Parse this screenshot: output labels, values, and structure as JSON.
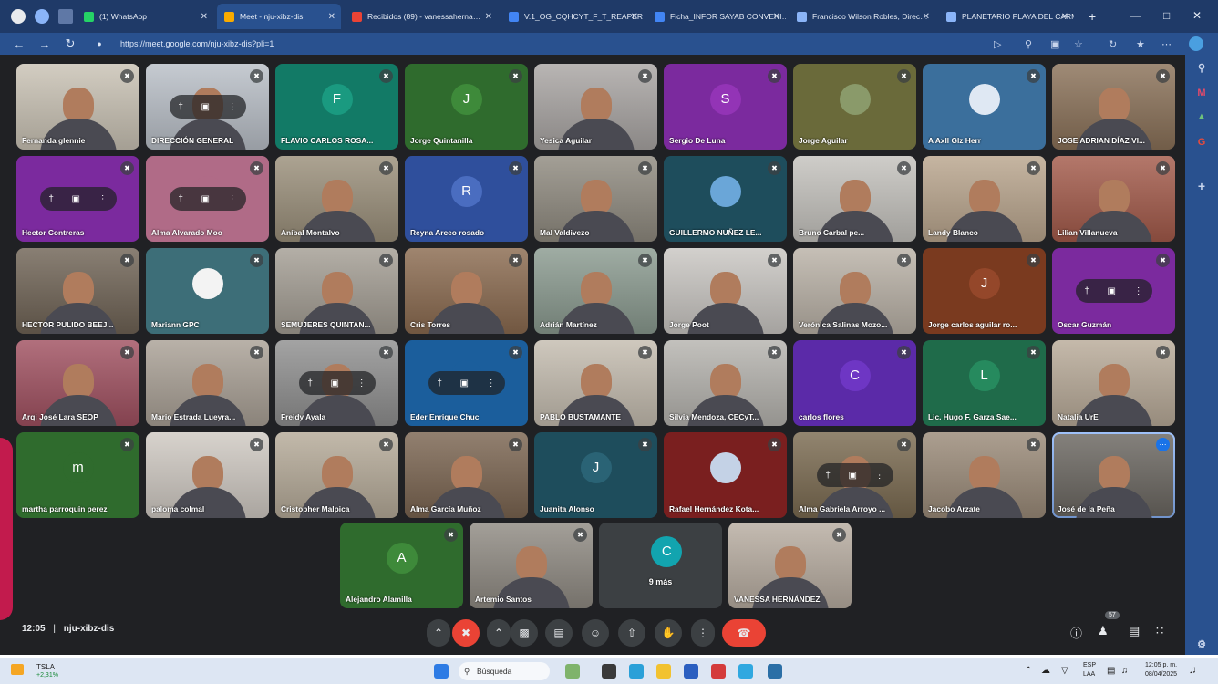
{
  "browser": {
    "tabs": [
      {
        "label": "(1) WhatsApp",
        "favicon": "whatsapp-icon",
        "color": "#25d366"
      },
      {
        "label": "Meet - nju-xibz-dis",
        "favicon": "meet-icon",
        "color": "#f9ab00",
        "active": true
      },
      {
        "label": "Recibidos (89) - vanessaherna…",
        "favicon": "gmail-icon",
        "color": "#ea4335"
      },
      {
        "label": "V.1_OG_CQHCYT_F_T_REAPER…",
        "favicon": "docs-icon",
        "color": "#4285f4"
      },
      {
        "label": "Ficha_INFOR SAYAB CONVENI…",
        "favicon": "docs-icon",
        "color": "#4285f4"
      },
      {
        "label": "Francisco Wilson Robles, Direc…",
        "favicon": "page-icon",
        "color": "#8ab4f8"
      },
      {
        "label": "PLANETARIO PLAYA DEL CARM…",
        "favicon": "page-icon",
        "color": "#8ab4f8"
      }
    ],
    "new_tab": "+",
    "url": "https://meet.google.com/nju-xibz-dis?pli=1"
  },
  "meet": {
    "time": "12:05",
    "separator": "|",
    "code": "nju-xibz-dis",
    "people_count": "57",
    "grid": [
      {
        "name": "Fernanda glennie",
        "kind": "video",
        "bg": "#c9c2b4"
      },
      {
        "name": "DIRECCIÓN GENERAL",
        "kind": "video",
        "bg": "#b9bfc7",
        "pill": true
      },
      {
        "name": "FLAVIO CARLOS ROSA...",
        "kind": "avatar",
        "letter": "F",
        "bg": "#127a66",
        "avatar_bg": "#1a9a80"
      },
      {
        "name": "Jorge Quintanilla",
        "kind": "avatar",
        "letter": "J",
        "bg": "#2f6b2d",
        "avatar_bg": "#3e8a3a"
      },
      {
        "name": "Yesica Aguilar",
        "kind": "video",
        "bg": "#a9a5a3"
      },
      {
        "name": "Sergio De Luna",
        "kind": "avatar",
        "letter": "S",
        "bg": "#7b2a9e",
        "avatar_bg": "#9334b6"
      },
      {
        "name": "Jorge Aguilar",
        "kind": "avatar",
        "letter": "",
        "bg": "#6a6a3a",
        "avatar_bg": "#8a9a6a"
      },
      {
        "name": "A Axll Glz Herr",
        "kind": "avatar",
        "letter": "",
        "bg": "#3b6f9c",
        "avatar_bg": "#dfe8f3"
      },
      {
        "name": "JOSE ADRIAN DÍAZ VI...",
        "kind": "video",
        "bg": "#8a7158"
      },
      {
        "name": "Hector Contreras",
        "kind": "avatar",
        "letter": "",
        "bg": "#7b2a9e",
        "avatar_bg": "#7b2a9e",
        "pill": true
      },
      {
        "name": "Alma Alvarado Moo",
        "kind": "avatar",
        "letter": "",
        "bg": "#b06b87",
        "avatar_bg": "#b06b87",
        "pill": true
      },
      {
        "name": "Aníbal Montalvo",
        "kind": "video",
        "bg": "#9a8f7a"
      },
      {
        "name": "Reyna Arceo rosado",
        "kind": "avatar",
        "letter": "R",
        "bg": "#2f4f9c",
        "avatar_bg": "#4a6dc0"
      },
      {
        "name": "Mal Valdivezo",
        "kind": "video",
        "bg": "#8f8a7f"
      },
      {
        "name": "GUILLERMO NUÑEZ LE...",
        "kind": "avatar",
        "letter": "",
        "bg": "#1e4d5c",
        "avatar_bg": "#6aa6d8"
      },
      {
        "name": "Bruno Carbal pe...",
        "kind": "video",
        "bg": "#c4c2bd"
      },
      {
        "name": "Landy Blanco",
        "kind": "video",
        "bg": "#b9a58d"
      },
      {
        "name": "Lilian Villanueva",
        "kind": "video",
        "bg": "#a35a4a"
      },
      {
        "name": "HECTOR PULIDO BEEJ...",
        "kind": "video",
        "bg": "#6f6355"
      },
      {
        "name": "Mariann GPC",
        "kind": "avatar",
        "letter": "",
        "bg": "#3d6e78",
        "avatar_bg": "#f3f3f3"
      },
      {
        "name": "SEMUJERES QUINTAN...",
        "kind": "video",
        "bg": "#a39d93"
      },
      {
        "name": "Cris Torres",
        "kind": "video",
        "bg": "#8a6a4f"
      },
      {
        "name": "Adrián Martínez",
        "kind": "video",
        "bg": "#8a9a8f"
      },
      {
        "name": "Jorge Poot",
        "kind": "video",
        "bg": "#c9c6c2"
      },
      {
        "name": "Verónica Salinas Mozo...",
        "kind": "video",
        "bg": "#b9b1a6"
      },
      {
        "name": "Jorge carlos aguilar ro...",
        "kind": "avatar",
        "letter": "J",
        "bg": "#7a3a1f",
        "avatar_bg": "#94472a"
      },
      {
        "name": "Oscar Guzmán",
        "kind": "avatar",
        "letter": "",
        "bg": "#7b2a9e",
        "avatar_bg": "#7b2a9e",
        "pill": true
      },
      {
        "name": "Arqi José Lara SEOP",
        "kind": "video",
        "bg": "#a05060"
      },
      {
        "name": "Mario Estrada Lueyra...",
        "kind": "video",
        "bg": "#a9a095"
      },
      {
        "name": "Freidy Ayala",
        "kind": "video",
        "bg": "#8f8f8f",
        "pill": true
      },
      {
        "name": "Eder Enrique Chuc",
        "kind": "avatar",
        "letter": "",
        "bg": "#1b5e9c",
        "avatar_bg": "#1b5e9c",
        "pill": true
      },
      {
        "name": "PABLO BUSTAMANTE",
        "kind": "video",
        "bg": "#c4bcaf"
      },
      {
        "name": "Silvia Mendoza, CECyT...",
        "kind": "video",
        "bg": "#b5b3ae"
      },
      {
        "name": "carlos flores",
        "kind": "avatar",
        "letter": "C",
        "bg": "#5b2aa8",
        "avatar_bg": "#6e36c4"
      },
      {
        "name": "Lic. Hugo F. Garza Sae...",
        "kind": "avatar",
        "letter": "L",
        "bg": "#1f6b4a",
        "avatar_bg": "#268a5e"
      },
      {
        "name": "Natalia UrE",
        "kind": "video",
        "bg": "#b8aa98"
      },
      {
        "name": "martha parroquin perez",
        "kind": "avatar",
        "letter": "m",
        "bg": "#2f6b2d",
        "avatar_bg": "#2f6b2d"
      },
      {
        "name": "paloma colmal",
        "kind": "video",
        "bg": "#cfc9c2"
      },
      {
        "name": "Cristopher Malpica",
        "kind": "video",
        "bg": "#b5aa98"
      },
      {
        "name": "Alma García Muñoz",
        "kind": "video",
        "bg": "#7a6450"
      },
      {
        "name": "Juanita Alonso",
        "kind": "avatar",
        "letter": "J",
        "bg": "#1e4d5c",
        "avatar_bg": "#2a6375"
      },
      {
        "name": "Rafael Hernández Kota...",
        "kind": "avatar",
        "letter": "",
        "bg": "#7a1f1f",
        "avatar_bg": "#c4d2e6"
      },
      {
        "name": "Alma Gabriela Arroyo ...",
        "kind": "video",
        "bg": "#7a6a50",
        "pill": true
      },
      {
        "name": "Jacobo Arzate",
        "kind": "video",
        "bg": "#9a8a78"
      },
      {
        "name": "José de la Peña",
        "kind": "video",
        "bg": "#6a6660",
        "border": true
      }
    ],
    "bottom_row": [
      {
        "name": "Alejandro Alamilla",
        "kind": "avatar",
        "letter": "A",
        "bg": "#2f6b2d",
        "avatar_bg": "#3e8a3a"
      },
      {
        "name": "Artemio Santos",
        "kind": "video",
        "bg": "#8f8a82"
      },
      {
        "name": "9 más",
        "kind": "more",
        "letter": "C",
        "bg": "#3c4043",
        "avatar_bg": "#12a4af"
      },
      {
        "name": "VANESSA HERNÁNDEZ",
        "kind": "video",
        "bg": "#b7aca0"
      }
    ]
  },
  "taskbar": {
    "stock": "TSLA",
    "stock_change": "+2,31%",
    "search_placeholder": "Búsqueda",
    "lang_top": "ESP",
    "lang_bottom": "LAA",
    "clock_time": "12:05 p. m.",
    "clock_date": "08/04/2025"
  }
}
